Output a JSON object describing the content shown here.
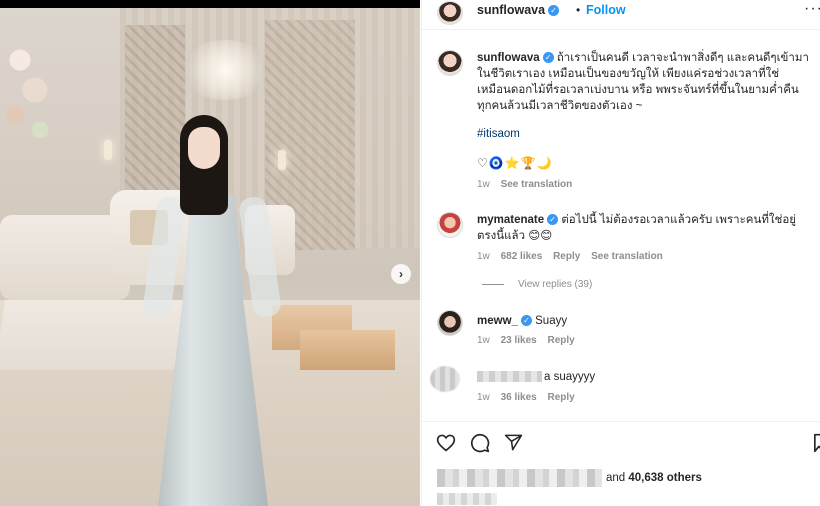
{
  "post": {
    "next_glyph": "›"
  },
  "header": {
    "username": "sunflowava",
    "verified_mark": "✓",
    "dot": "•",
    "follow_label": "Follow",
    "more_glyph": "···"
  },
  "caption": {
    "username": "sunflowava",
    "text": "ถ้าเราเป็นคนดี เวลาจะนำพาสิ่งดีๆ และคนดีๆเข้ามาในชีวิตเราเอง เหมือนเป็นของขวัญให้ เพียงแค่รอช่วงเวลาที่ใช่ เหมือนดอกไม้ที่รอเวลาเบ่งบาน หรือ พพระจันทร์ที่ขึ้นในยามค่ำคืน ทุกคนล้วนมีเวลาชีวิตของตัวเอง ~",
    "hashtag": "#itisaom",
    "emojis": "♡🧿⭐🏆🌙",
    "time": "1w",
    "see_translation": "See translation"
  },
  "comments": [
    {
      "username": "mymatenate",
      "text": "ต่อไปนี้ ไม่ต้องรอเวลาแล้วครับ เพราะคนที่ใช่อยู่ตรงนี้แล้ว 😊😊",
      "time": "1w",
      "likes": "682 likes",
      "reply": "Reply",
      "see_translation": "See translation"
    },
    {
      "username": "meww_",
      "text": "Suayy",
      "time": "1w",
      "likes": "23 likes",
      "reply": "Reply"
    },
    {
      "text": "a suayyyy",
      "time": "1w",
      "likes": "36 likes",
      "reply": "Reply"
    }
  ],
  "view_replies": "View replies (39)",
  "likes_summary": {
    "prefix": "and",
    "count": "40,638 others"
  },
  "colors": {
    "link": "#0095f6",
    "hashtag": "#00376b",
    "verified": "#3897f0",
    "muted": "#8e8e8e"
  }
}
